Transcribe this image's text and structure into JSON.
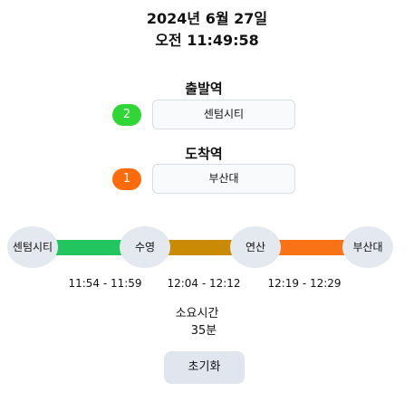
{
  "header": {
    "date": "2024년 6월 27일",
    "time": "오전 11:49:58"
  },
  "origin": {
    "label": "출발역",
    "line_number": "2",
    "line_color": "#2fd636",
    "station": "센텀시티"
  },
  "destination": {
    "label": "도착역",
    "line_number": "1",
    "line_color": "#ff6b0a",
    "station": "부산대"
  },
  "route": {
    "stations": [
      "센텀시티",
      "수영",
      "연산",
      "부산대"
    ],
    "segments": [
      {
        "color": "#22c55e",
        "time": "11:54 - 11:59"
      },
      {
        "color": "#ca8a04",
        "time": "12:04 - 12:12"
      },
      {
        "color": "#f97316",
        "time": "12:19 - 12:29"
      }
    ]
  },
  "summary": {
    "duration_label": "소요시간",
    "duration_value": "35분"
  },
  "actions": {
    "reset_label": "초기화"
  }
}
